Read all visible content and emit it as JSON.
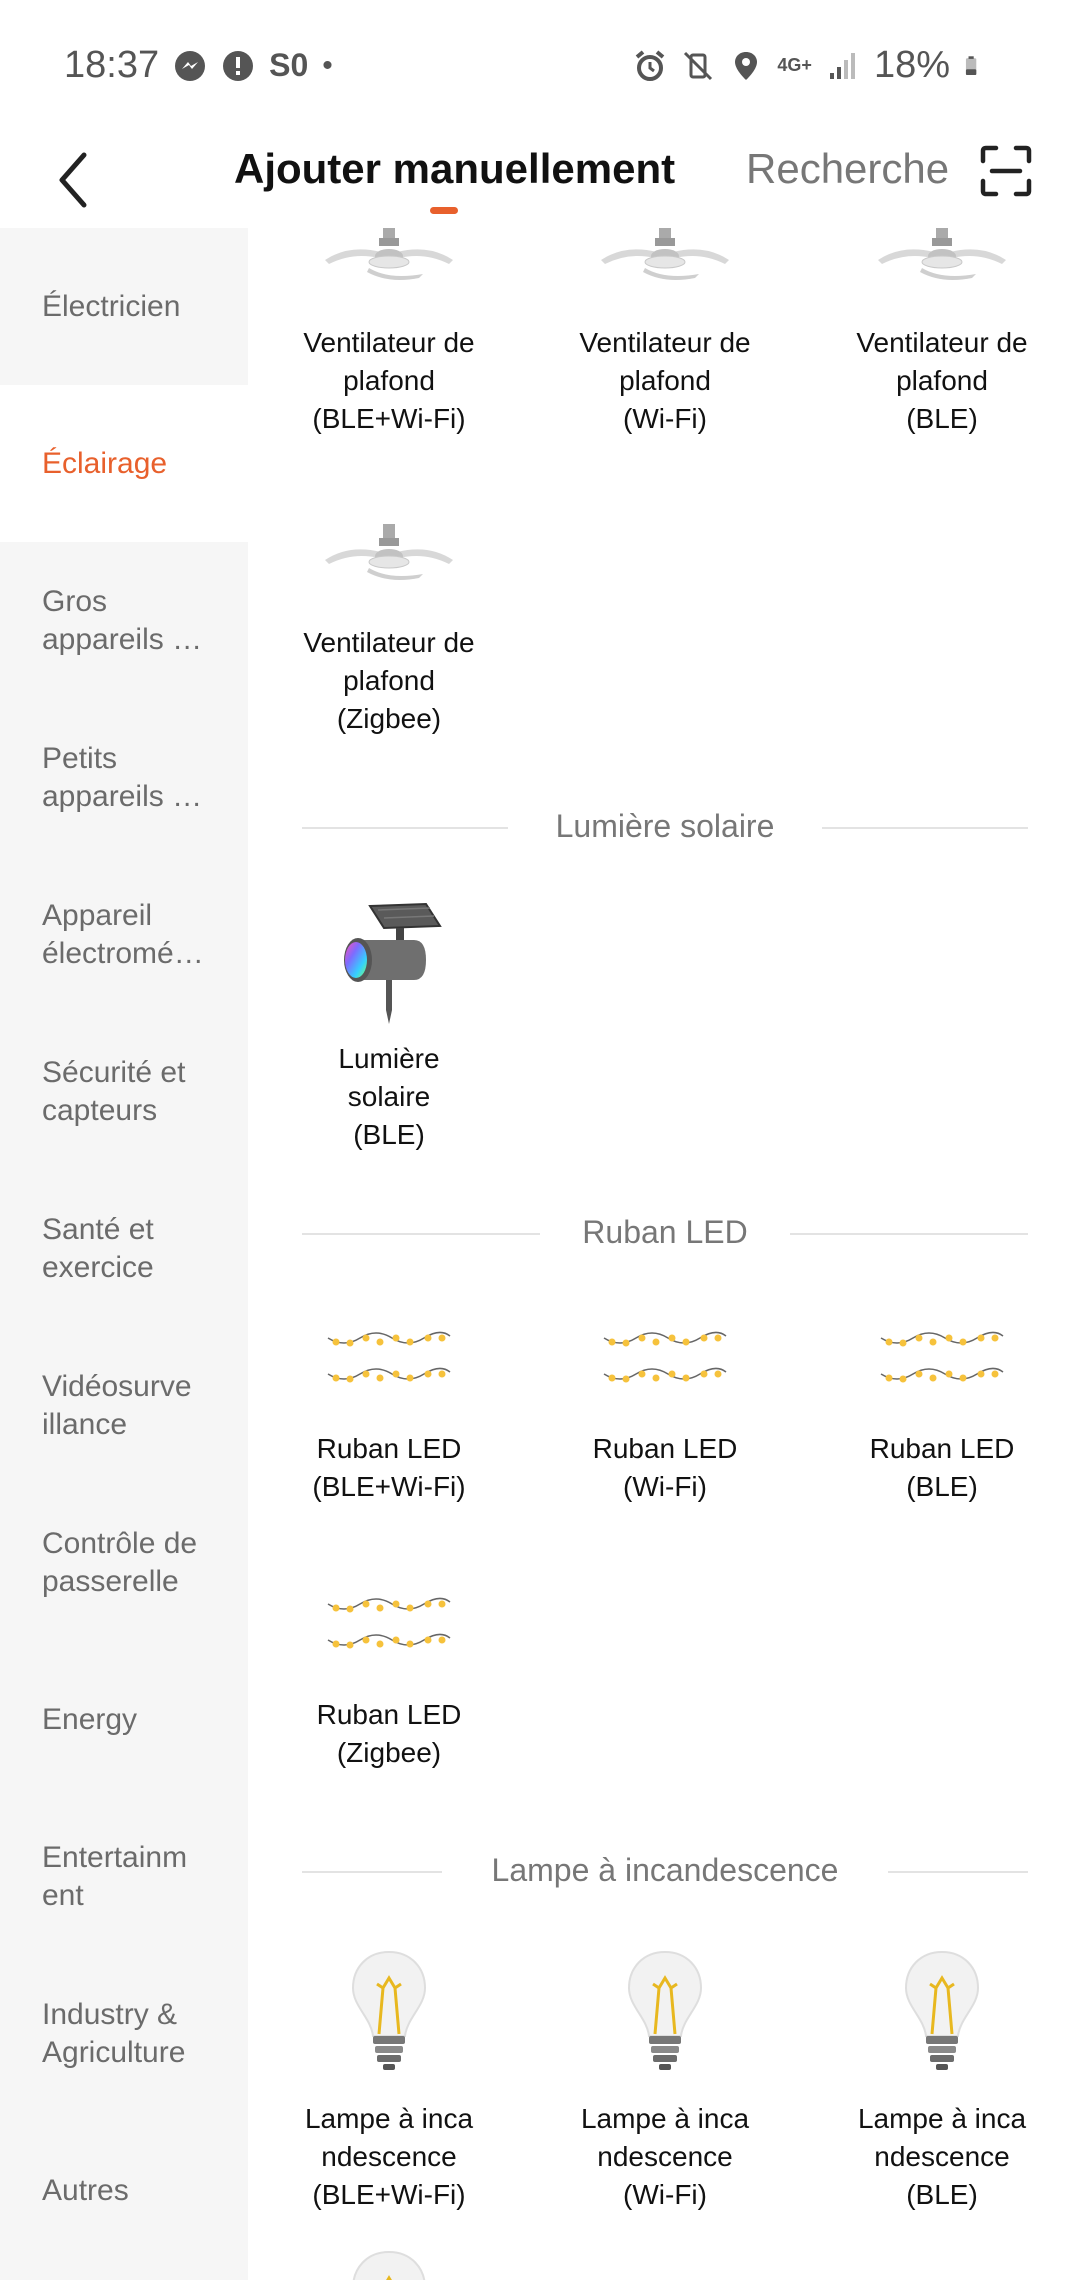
{
  "status": {
    "time": "18:37",
    "sim": "S0",
    "dot": "•",
    "network": "4G+",
    "battery": "18%"
  },
  "header": {
    "title": "Ajouter manuellement",
    "search_label": "Recherche"
  },
  "sidebar": {
    "items": [
      {
        "label": "Électricien"
      },
      {
        "label": "Éclairage"
      },
      {
        "label": "Gros appareils …"
      },
      {
        "label": "Petits appareils …"
      },
      {
        "label": "Appareil électromé…"
      },
      {
        "label": "Sécurité et capteurs"
      },
      {
        "label": "Santé et exercice"
      },
      {
        "label": "Vidéosurve illance"
      },
      {
        "label": "Contrôle de passerelle"
      },
      {
        "label": "Energy"
      },
      {
        "label": "Entertainm ent"
      },
      {
        "label": "Industry & Agriculture"
      },
      {
        "label": "Autres"
      }
    ]
  },
  "sections": {
    "solar": "Lumière solaire",
    "led": "Ruban LED",
    "incandescent": "Lampe à incandescence"
  },
  "devices": {
    "fan_ble_wifi": [
      "Ventilateur de",
      "plafond",
      "(BLE+Wi-Fi)"
    ],
    "fan_wifi": [
      "Ventilateur de",
      "plafond",
      "(Wi-Fi)"
    ],
    "fan_ble": [
      "Ventilateur de",
      "plafond",
      "(BLE)"
    ],
    "fan_zigbee": [
      "Ventilateur de",
      "plafond",
      "(Zigbee)"
    ],
    "solar_ble": [
      "Lumière",
      "solaire",
      "(BLE)"
    ],
    "led_ble_wifi": [
      "Ruban LED",
      "(BLE+Wi-Fi)"
    ],
    "led_wifi": [
      "Ruban LED",
      "(Wi-Fi)"
    ],
    "led_ble": [
      "Ruban LED",
      "(BLE)"
    ],
    "led_zigbee": [
      "Ruban LED",
      "(Zigbee)"
    ],
    "bulb_ble_wifi": [
      "Lampe à inca",
      "ndescence",
      "(BLE+Wi-Fi)"
    ],
    "bulb_wifi": [
      "Lampe à inca",
      "ndescence",
      "(Wi-Fi)"
    ],
    "bulb_ble": [
      "Lampe à inca",
      "ndescence",
      "(BLE)"
    ]
  },
  "icons": {
    "fan": "ceiling-fan-icon",
    "solar": "solar-light-icon",
    "led": "led-strip-icon",
    "bulb": "filament-bulb-icon"
  },
  "colors": {
    "accent": "#e8602c",
    "sidebar_bg": "#f6f6f6",
    "text_muted": "#777777"
  }
}
